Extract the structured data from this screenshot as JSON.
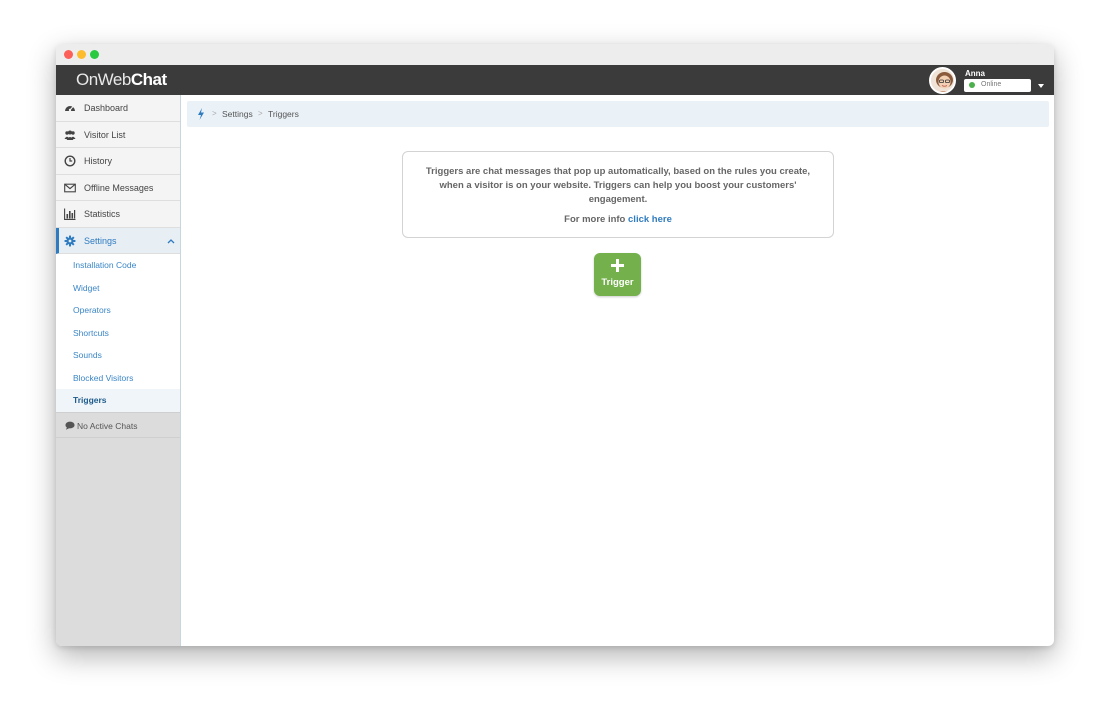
{
  "app": {
    "logo_prefix": "OnWeb",
    "logo_suffix": "Chat"
  },
  "user": {
    "name": "Anna",
    "status": "Online",
    "status_color": "#4cb04c"
  },
  "sidebar": {
    "items": [
      {
        "label": "Dashboard",
        "icon": "dashboard-icon"
      },
      {
        "label": "Visitor List",
        "icon": "users-icon"
      },
      {
        "label": "History",
        "icon": "clock-icon"
      },
      {
        "label": "Offline Messages",
        "icon": "envelope-icon"
      },
      {
        "label": "Statistics",
        "icon": "bar-chart-icon"
      },
      {
        "label": "Settings",
        "icon": "gear-icon"
      }
    ],
    "submenu": [
      {
        "label": "Installation Code"
      },
      {
        "label": "Widget"
      },
      {
        "label": "Operators"
      },
      {
        "label": "Shortcuts"
      },
      {
        "label": "Sounds"
      },
      {
        "label": "Blocked Visitors"
      },
      {
        "label": "Triggers"
      }
    ],
    "no_chats": "No Active Chats"
  },
  "breadcrumb": {
    "items": [
      "Settings",
      "Triggers"
    ],
    "separator": ">"
  },
  "info": {
    "text": "Triggers are chat messages that pop up automatically, based on the rules you create, when a visitor is on your website. Triggers can help you boost your customers' engagement.",
    "more_prefix": "For more info",
    "more_link": "click here"
  },
  "trigger_button": {
    "label": "Trigger"
  },
  "colors": {
    "accent": "#2f7bc0",
    "topbar": "#3b3b3b",
    "button_green": "#74b04c"
  }
}
